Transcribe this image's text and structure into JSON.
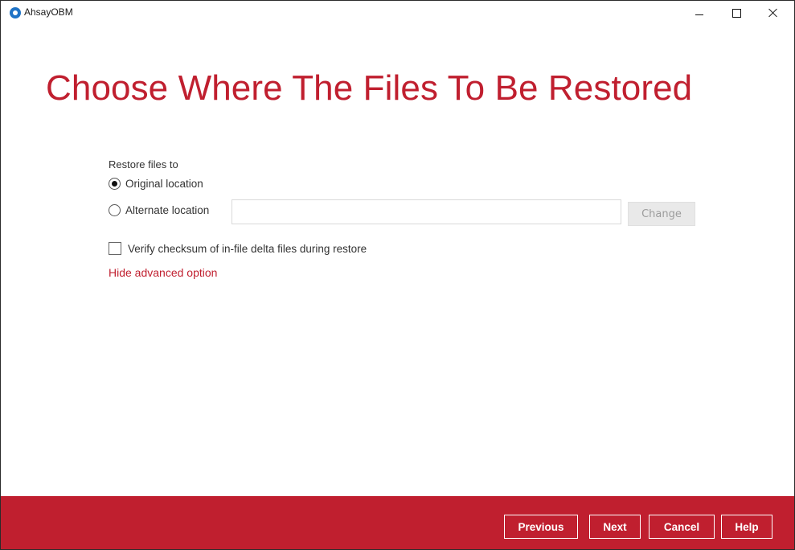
{
  "window": {
    "title": "AhsayOBM"
  },
  "page": {
    "heading": "Choose Where The Files To Be Restored"
  },
  "restore": {
    "label": "Restore files to",
    "original_label": "Original location",
    "alternate_label": "Alternate location",
    "alternate_value": "",
    "change_label": "Change",
    "verify_label": "Verify checksum of in-file delta files during restore",
    "advanced_link": "Hide advanced option"
  },
  "footer": {
    "previous": "Previous",
    "next": "Next",
    "cancel": "Cancel",
    "help": "Help"
  },
  "colors": {
    "accent": "#c01f2f",
    "app_icon": "#1f73c6"
  }
}
